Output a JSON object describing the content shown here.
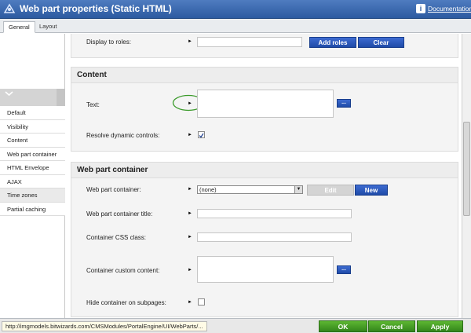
{
  "window": {
    "title": "Web part properties (Static HTML)",
    "documentation_label": "Documentation"
  },
  "tabs": [
    {
      "label": "General",
      "active": true
    },
    {
      "label": "Layout",
      "active": false
    }
  ],
  "leftnav": {
    "items": [
      {
        "label": "Default"
      },
      {
        "label": "Visibility"
      },
      {
        "label": "Content"
      },
      {
        "label": "Web part container"
      },
      {
        "label": "HTML Envelope"
      },
      {
        "label": "AJAX"
      },
      {
        "label": "Time zones",
        "selected": true
      },
      {
        "label": "Partial caching"
      }
    ]
  },
  "visibility_section": {
    "display_to_roles_label": "Display to roles:",
    "display_to_roles_value": "",
    "add_roles_label": "Add roles",
    "clear_label": "Clear"
  },
  "content_section": {
    "heading": "Content",
    "text_label": "Text:",
    "text_value": "",
    "dots_label": "...",
    "resolve_label": "Resolve dynamic controls:",
    "resolve_checked": true
  },
  "container_section": {
    "heading": "Web part container",
    "container_label": "Web part container:",
    "container_value": "(none)",
    "edit_label": "Edit",
    "new_label": "New",
    "container_title_label": "Web part container title:",
    "container_title_value": "",
    "css_class_label": "Container CSS class:",
    "css_class_value": "",
    "custom_content_label": "Container custom content:",
    "custom_content_value": "",
    "dots_label": "...",
    "hide_label": "Hide container on subpages:",
    "hide_checked": false
  },
  "footer": {
    "status_url": "http://imgmodels.bitwizards.com/CMSModules/PortalEngine/UI/WebParts/...",
    "ok_label": "OK",
    "cancel_label": "Cancel",
    "apply_label": "Apply"
  },
  "colors": {
    "titlebar": "#2c5aa0",
    "blue_button": "#2a59c0",
    "green_button": "#44a024",
    "highlight_ellipse": "#3a9a2a"
  }
}
